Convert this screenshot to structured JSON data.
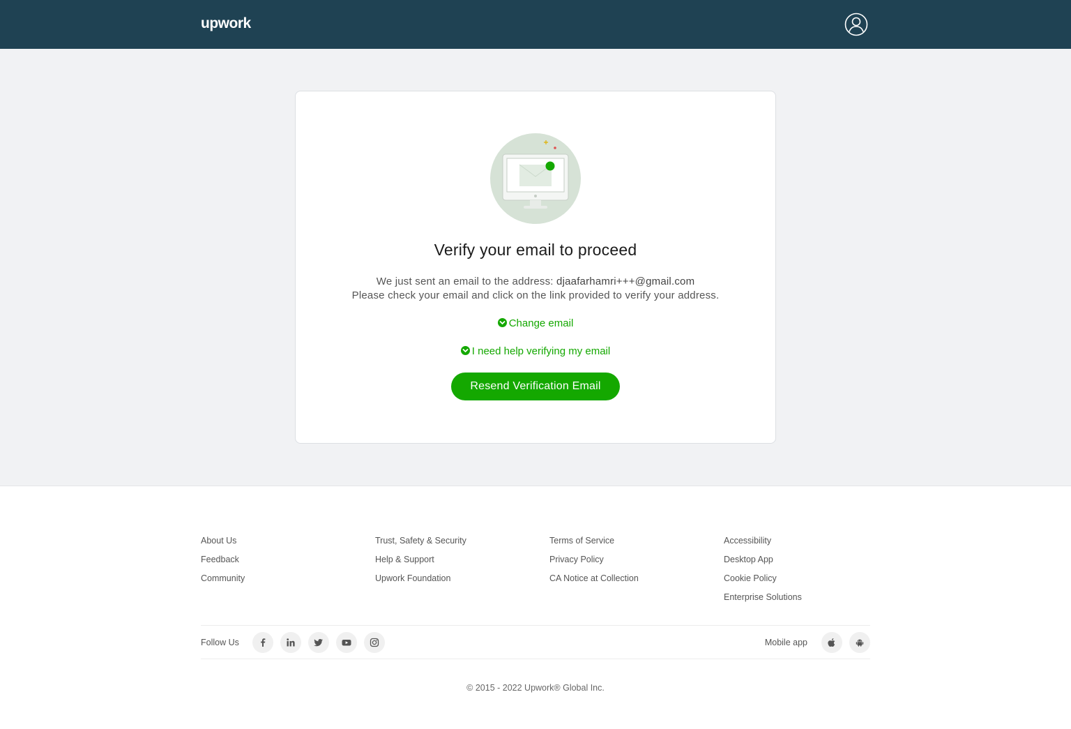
{
  "header": {
    "logo": "upwork",
    "avatar_icon": "user-circle-icon"
  },
  "card": {
    "illustration_icon": "monitor-email-icon",
    "title": "Verify your email to proceed",
    "message_prefix": "We just sent an email to the address: ",
    "email": "djaafarhamri+++@gmail.com",
    "message_line2": "Please check your email and click on the link provided to verify your address.",
    "change_email_label": "Change email",
    "help_label": "I need help verifying my email",
    "resend_label": "Resend Verification Email"
  },
  "footer": {
    "col1": [
      "About Us",
      "Feedback",
      "Community"
    ],
    "col2": [
      "Trust, Safety & Security",
      "Help & Support",
      "Upwork Foundation"
    ],
    "col3": [
      "Terms of Service",
      "Privacy Policy",
      "CA Notice at Collection"
    ],
    "col4": [
      "Accessibility",
      "Desktop App",
      "Cookie Policy",
      "Enterprise Solutions"
    ],
    "follow_label": "Follow Us",
    "social_icons": [
      "facebook-icon",
      "linkedin-icon",
      "twitter-icon",
      "youtube-icon",
      "instagram-icon"
    ],
    "mobile_label": "Mobile app",
    "mobile_icons": [
      "apple-icon",
      "android-icon"
    ],
    "copyright": "© 2015 - 2022 Upwork® Global Inc."
  },
  "colors": {
    "header_bg": "#1f4253",
    "accent_green": "#14a800",
    "page_bg": "#f1f2f4"
  }
}
